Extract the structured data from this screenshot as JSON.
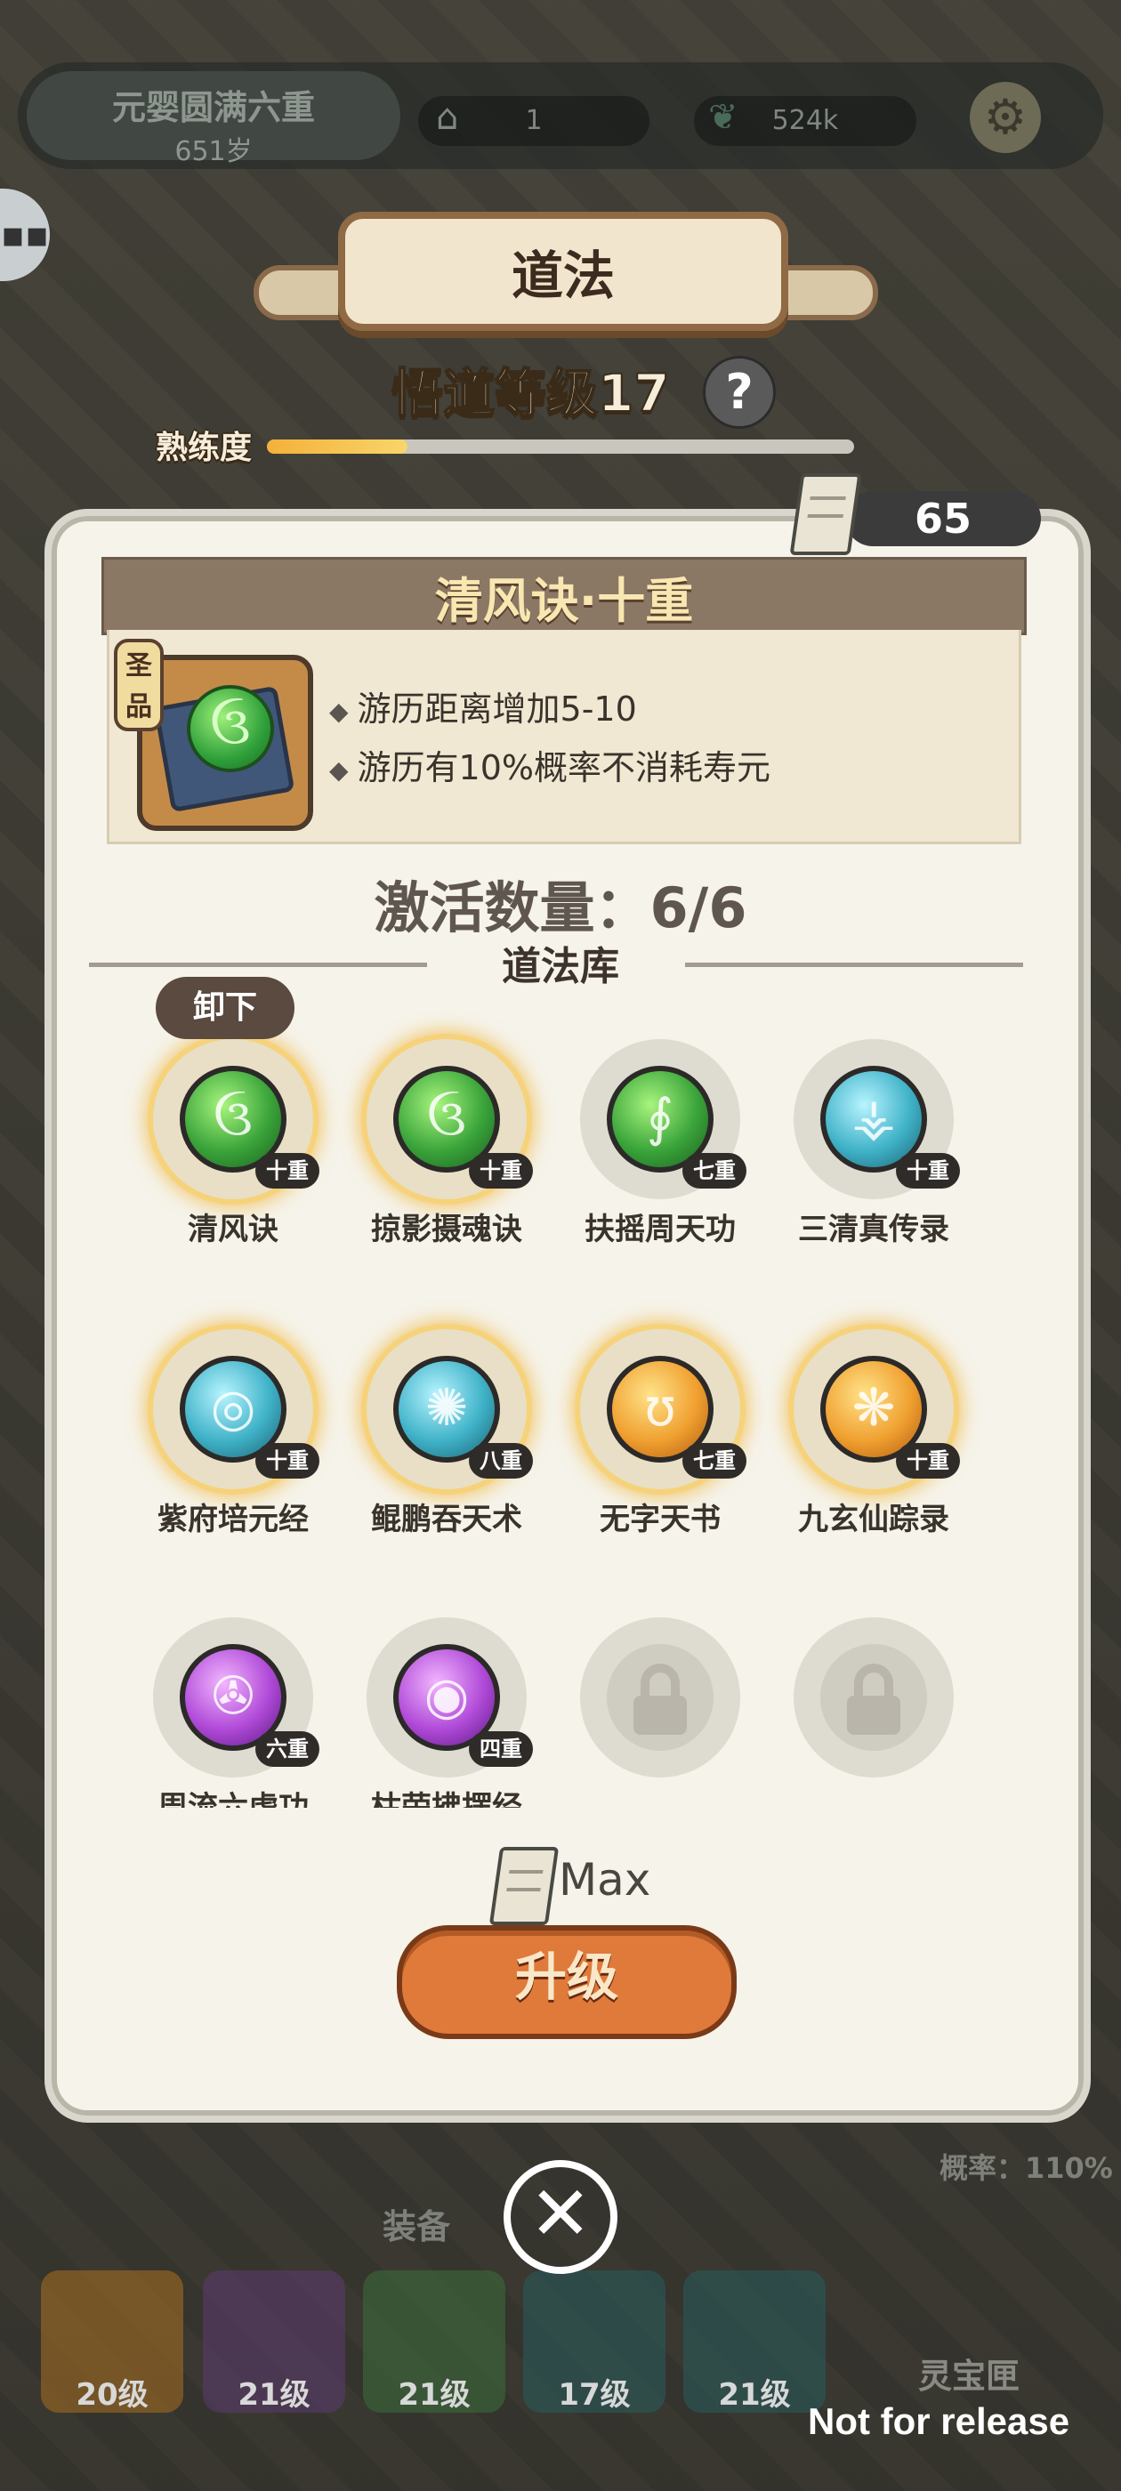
{
  "background": {
    "realm": "元婴圆满六重",
    "age": "651岁",
    "res1": "1",
    "res2": "524k",
    "bottom_title": "装备",
    "rate": "概率：110%",
    "treasure": "灵宝匣",
    "equip_levels": [
      "20级",
      "21级",
      "21级",
      "17级",
      "21级"
    ]
  },
  "header": {
    "title": "道法",
    "level_text": "悟道等级17",
    "help": "?",
    "proficiency_label": "熟练度",
    "proficiency_fraction": 0.24
  },
  "scroll_count": "65",
  "selected": {
    "name": "清风诀·十重",
    "grade": "圣品",
    "effects": [
      "游历距离增加5-10",
      "游历有10%概率不消耗寿元"
    ]
  },
  "active_count": "激活数量：6/6",
  "library_title": "道法库",
  "unequip_label": "卸下",
  "skills": [
    {
      "name": "清风诀",
      "level": "十重",
      "color": "green",
      "glyph": "ઉ"
    },
    {
      "name": "掠影摄魂诀",
      "level": "十重",
      "color": "green",
      "glyph": "ઉ"
    },
    {
      "name": "扶摇周天功",
      "level": "七重",
      "color": "green",
      "glyph": "∮"
    },
    {
      "name": "三清真传录",
      "level": "十重",
      "color": "cyan",
      "glyph": "⚶"
    },
    {
      "name": "紫府培元经",
      "level": "十重",
      "color": "cyan",
      "glyph": "◎"
    },
    {
      "name": "鲲鹏吞天术",
      "level": "八重",
      "color": "cyan",
      "glyph": "✺"
    },
    {
      "name": "无字天书",
      "level": "七重",
      "color": "orange",
      "glyph": "ʊ"
    },
    {
      "name": "九玄仙踪录",
      "level": "十重",
      "color": "orange",
      "glyph": "❋"
    },
    {
      "name": "周流六虚功",
      "level": "六重",
      "color": "purple",
      "glyph": "✇"
    },
    {
      "name": "枯荣拂摆经",
      "level": "四重",
      "color": "purple",
      "glyph": "◉"
    }
  ],
  "max_label": "Max",
  "upgrade_label": "升级",
  "close_icon": "close-icon",
  "watermark": "Not for release",
  "colors": {
    "accent": "#e07a3a",
    "banner": "#8a7764",
    "panel": "#f5f3ea"
  }
}
